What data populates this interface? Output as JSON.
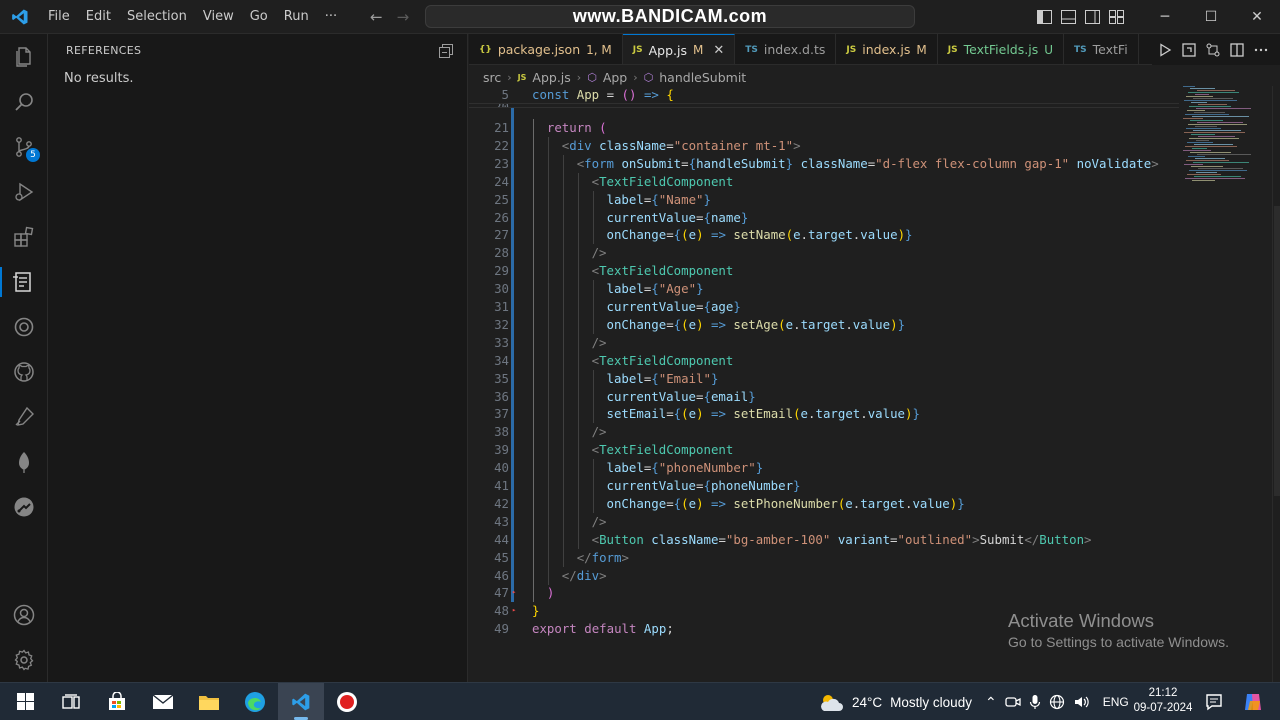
{
  "window": {
    "watermark": "www.BANDICAM.com",
    "menu": [
      "File",
      "Edit",
      "Selection",
      "View",
      "Go",
      "Run",
      "···"
    ],
    "nav_back": "←",
    "nav_forward": "→",
    "minimize": "─",
    "maximize": "☐",
    "close": "✕"
  },
  "activity_bar": {
    "items": [
      {
        "name": "explorer-icon"
      },
      {
        "name": "search-icon"
      },
      {
        "name": "source-control-icon",
        "badge": "5"
      },
      {
        "name": "run-debug-icon"
      },
      {
        "name": "extensions-icon"
      },
      {
        "name": "references-icon",
        "active": true
      },
      {
        "name": "remote-icon"
      },
      {
        "name": "github-icon"
      },
      {
        "name": "testing-icon"
      },
      {
        "name": "mongodb-icon"
      },
      {
        "name": "gitlens-icon"
      }
    ],
    "bottom": [
      {
        "name": "account-icon"
      },
      {
        "name": "settings-gear-icon"
      }
    ]
  },
  "sidebar": {
    "title": "REFERENCES",
    "empty_message": "No results."
  },
  "tabs": [
    {
      "label": "package.json",
      "type": "json",
      "icon": "{}",
      "status": "1, M",
      "state": "mod"
    },
    {
      "label": "App.js",
      "type": "js",
      "icon": "JS",
      "status": "M",
      "state": "active"
    },
    {
      "label": "index.d.ts",
      "type": "ts",
      "icon": "TS",
      "status": "",
      "state": "plain"
    },
    {
      "label": "index.js",
      "type": "js",
      "icon": "JS",
      "status": "M",
      "state": "mod"
    },
    {
      "label": "TextFields.js",
      "type": "js",
      "icon": "JS",
      "status": "U",
      "state": "untracked"
    },
    {
      "label": "TextFi",
      "type": "ts",
      "icon": "TS",
      "status": "",
      "state": "plain"
    }
  ],
  "breadcrumb": {
    "folder": "src",
    "file": "App.js",
    "component": "App",
    "symbol": "handleSubmit"
  },
  "code": {
    "sticky_lines": [
      {
        "num": "5",
        "tokens": [
          [
            "k",
            "const "
          ],
          [
            "f",
            "App"
          ],
          [
            "w",
            " = "
          ],
          [
            "b2",
            "()"
          ],
          [
            "w",
            " "
          ],
          [
            "k",
            "=>"
          ],
          [
            "w",
            " "
          ],
          [
            "b1",
            "{"
          ]
        ]
      },
      {
        "num": "20",
        "tokens": []
      }
    ],
    "lines": [
      {
        "num": "21",
        "indent": 1,
        "tokens": [
          [
            "c",
            "return"
          ],
          [
            "w",
            " "
          ],
          [
            "b2",
            "("
          ]
        ]
      },
      {
        "num": "22",
        "indent": 2,
        "tokens": [
          [
            "p",
            "<"
          ],
          [
            "k",
            "div"
          ],
          [
            "w",
            " "
          ],
          [
            "v",
            "className"
          ],
          [
            "w",
            "="
          ],
          [
            "s",
            "\"container mt-1\""
          ],
          [
            "p",
            ">"
          ]
        ]
      },
      {
        "num": "23",
        "indent": 3,
        "tokens": [
          [
            "p",
            "<"
          ],
          [
            "k",
            "form"
          ],
          [
            "w",
            " "
          ],
          [
            "v",
            "onSubmit"
          ],
          [
            "w",
            "="
          ],
          [
            "k",
            "{"
          ],
          [
            "v",
            "handleSubmit"
          ],
          [
            "k",
            "}"
          ],
          [
            "w",
            " "
          ],
          [
            "v",
            "className"
          ],
          [
            "w",
            "="
          ],
          [
            "s",
            "\"d-flex flex-column gap-1\""
          ],
          [
            "w",
            " "
          ],
          [
            "v",
            "noValidate"
          ],
          [
            "p",
            ">"
          ]
        ]
      },
      {
        "num": "24",
        "indent": 4,
        "tokens": [
          [
            "p",
            "<"
          ],
          [
            "t",
            "TextFieldComponent"
          ]
        ]
      },
      {
        "num": "25",
        "indent": 5,
        "tokens": [
          [
            "v",
            "label"
          ],
          [
            "w",
            "="
          ],
          [
            "k",
            "{"
          ],
          [
            "s",
            "\"Name\""
          ],
          [
            "k",
            "}"
          ]
        ]
      },
      {
        "num": "26",
        "indent": 5,
        "tokens": [
          [
            "v",
            "currentValue"
          ],
          [
            "w",
            "="
          ],
          [
            "k",
            "{"
          ],
          [
            "v",
            "name"
          ],
          [
            "k",
            "}"
          ]
        ]
      },
      {
        "num": "27",
        "indent": 5,
        "tokens": [
          [
            "v",
            "onChange"
          ],
          [
            "w",
            "="
          ],
          [
            "k",
            "{"
          ],
          [
            "b1",
            "("
          ],
          [
            "v",
            "e"
          ],
          [
            "b1",
            ")"
          ],
          [
            "w",
            " "
          ],
          [
            "k",
            "=>"
          ],
          [
            "w",
            " "
          ],
          [
            "f",
            "setName"
          ],
          [
            "b1",
            "("
          ],
          [
            "v",
            "e"
          ],
          [
            "w",
            "."
          ],
          [
            "v",
            "target"
          ],
          [
            "w",
            "."
          ],
          [
            "v",
            "value"
          ],
          [
            "b1",
            ")"
          ],
          [
            "k",
            "}"
          ]
        ]
      },
      {
        "num": "28",
        "indent": 4,
        "tokens": [
          [
            "p",
            "/>"
          ]
        ]
      },
      {
        "num": "29",
        "indent": 4,
        "tokens": [
          [
            "p",
            "<"
          ],
          [
            "t",
            "TextFieldComponent"
          ]
        ]
      },
      {
        "num": "30",
        "indent": 5,
        "tokens": [
          [
            "v",
            "label"
          ],
          [
            "w",
            "="
          ],
          [
            "k",
            "{"
          ],
          [
            "s",
            "\"Age\""
          ],
          [
            "k",
            "}"
          ]
        ]
      },
      {
        "num": "31",
        "indent": 5,
        "tokens": [
          [
            "v",
            "currentValue"
          ],
          [
            "w",
            "="
          ],
          [
            "k",
            "{"
          ],
          [
            "v",
            "age"
          ],
          [
            "k",
            "}"
          ]
        ]
      },
      {
        "num": "32",
        "indent": 5,
        "tokens": [
          [
            "v",
            "onChange"
          ],
          [
            "w",
            "="
          ],
          [
            "k",
            "{"
          ],
          [
            "b1",
            "("
          ],
          [
            "v",
            "e"
          ],
          [
            "b1",
            ")"
          ],
          [
            "w",
            " "
          ],
          [
            "k",
            "=>"
          ],
          [
            "w",
            " "
          ],
          [
            "f",
            "setAge"
          ],
          [
            "b1",
            "("
          ],
          [
            "v",
            "e"
          ],
          [
            "w",
            "."
          ],
          [
            "v",
            "target"
          ],
          [
            "w",
            "."
          ],
          [
            "v",
            "value"
          ],
          [
            "b1",
            ")"
          ],
          [
            "k",
            "}"
          ]
        ]
      },
      {
        "num": "33",
        "indent": 4,
        "tokens": [
          [
            "p",
            "/>"
          ]
        ]
      },
      {
        "num": "34",
        "indent": 4,
        "tokens": [
          [
            "p",
            "<"
          ],
          [
            "t",
            "TextFieldComponent"
          ]
        ]
      },
      {
        "num": "35",
        "indent": 5,
        "tokens": [
          [
            "v",
            "label"
          ],
          [
            "w",
            "="
          ],
          [
            "k",
            "{"
          ],
          [
            "s",
            "\"Email\""
          ],
          [
            "k",
            "}"
          ]
        ]
      },
      {
        "num": "36",
        "indent": 5,
        "tokens": [
          [
            "v",
            "currentValue"
          ],
          [
            "w",
            "="
          ],
          [
            "k",
            "{"
          ],
          [
            "v",
            "email"
          ],
          [
            "k",
            "}"
          ]
        ]
      },
      {
        "num": "37",
        "indent": 5,
        "tokens": [
          [
            "v",
            "setEmail"
          ],
          [
            "w",
            "="
          ],
          [
            "k",
            "{"
          ],
          [
            "b1",
            "("
          ],
          [
            "v",
            "e"
          ],
          [
            "b1",
            ")"
          ],
          [
            "w",
            " "
          ],
          [
            "k",
            "=>"
          ],
          [
            "w",
            " "
          ],
          [
            "f",
            "setEmail"
          ],
          [
            "b1",
            "("
          ],
          [
            "v",
            "e"
          ],
          [
            "w",
            "."
          ],
          [
            "v",
            "target"
          ],
          [
            "w",
            "."
          ],
          [
            "v",
            "value"
          ],
          [
            "b1",
            ")"
          ],
          [
            "k",
            "}"
          ]
        ]
      },
      {
        "num": "38",
        "indent": 4,
        "tokens": [
          [
            "p",
            "/>"
          ]
        ]
      },
      {
        "num": "39",
        "indent": 4,
        "tokens": [
          [
            "p",
            "<"
          ],
          [
            "t",
            "TextFieldComponent"
          ]
        ]
      },
      {
        "num": "40",
        "indent": 5,
        "tokens": [
          [
            "v",
            "label"
          ],
          [
            "w",
            "="
          ],
          [
            "k",
            "{"
          ],
          [
            "s",
            "\"phoneNumber\""
          ],
          [
            "k",
            "}"
          ]
        ]
      },
      {
        "num": "41",
        "indent": 5,
        "tokens": [
          [
            "v",
            "currentValue"
          ],
          [
            "w",
            "="
          ],
          [
            "k",
            "{"
          ],
          [
            "v",
            "phoneNumber"
          ],
          [
            "k",
            "}"
          ]
        ]
      },
      {
        "num": "42",
        "indent": 5,
        "tokens": [
          [
            "v",
            "onChange"
          ],
          [
            "w",
            "="
          ],
          [
            "k",
            "{"
          ],
          [
            "b1",
            "("
          ],
          [
            "v",
            "e"
          ],
          [
            "b1",
            ")"
          ],
          [
            "w",
            " "
          ],
          [
            "k",
            "=>"
          ],
          [
            "w",
            " "
          ],
          [
            "f",
            "setPhoneNumber"
          ],
          [
            "b1",
            "("
          ],
          [
            "v",
            "e"
          ],
          [
            "w",
            "."
          ],
          [
            "v",
            "target"
          ],
          [
            "w",
            "."
          ],
          [
            "v",
            "value"
          ],
          [
            "b1",
            ")"
          ],
          [
            "k",
            "}"
          ]
        ]
      },
      {
        "num": "43",
        "indent": 4,
        "tokens": [
          [
            "p",
            "/>"
          ]
        ]
      },
      {
        "num": "44",
        "indent": 4,
        "tokens": [
          [
            "p",
            "<"
          ],
          [
            "t",
            "Button"
          ],
          [
            "w",
            " "
          ],
          [
            "v",
            "className"
          ],
          [
            "w",
            "="
          ],
          [
            "s",
            "\"bg-amber-100\""
          ],
          [
            "w",
            " "
          ],
          [
            "v",
            "variant"
          ],
          [
            "w",
            "="
          ],
          [
            "s",
            "\"outlined\""
          ],
          [
            "p",
            ">"
          ],
          [
            "w",
            "Submit"
          ],
          [
            "p",
            "</"
          ],
          [
            "t",
            "Button"
          ],
          [
            "p",
            ">"
          ]
        ]
      },
      {
        "num": "45",
        "indent": 3,
        "tokens": [
          [
            "p",
            "</"
          ],
          [
            "k",
            "form"
          ],
          [
            "p",
            ">"
          ]
        ]
      },
      {
        "num": "46",
        "indent": 2,
        "tokens": [
          [
            "p",
            "</"
          ],
          [
            "k",
            "div"
          ],
          [
            "p",
            ">"
          ]
        ]
      },
      {
        "num": "47",
        "indent": 1,
        "tokens": [
          [
            "b2",
            ")"
          ]
        ]
      },
      {
        "num": "48",
        "indent": 0,
        "tokens": [
          [
            "b1",
            "}"
          ]
        ]
      },
      {
        "num": "49",
        "indent": 0,
        "tokens": [
          [
            "c",
            "export"
          ],
          [
            "w",
            " "
          ],
          [
            "c",
            "default"
          ],
          [
            "w",
            " "
          ],
          [
            "v",
            "App"
          ],
          [
            "w",
            ";"
          ]
        ]
      }
    ]
  },
  "activate_windows": {
    "title": "Activate Windows",
    "subtitle": "Go to Settings to activate Windows."
  },
  "taskbar": {
    "weather_temp": "24°C",
    "weather_text": "Mostly cloudy",
    "language": "ENG",
    "time": "21:12",
    "date": "09-07-2024"
  }
}
